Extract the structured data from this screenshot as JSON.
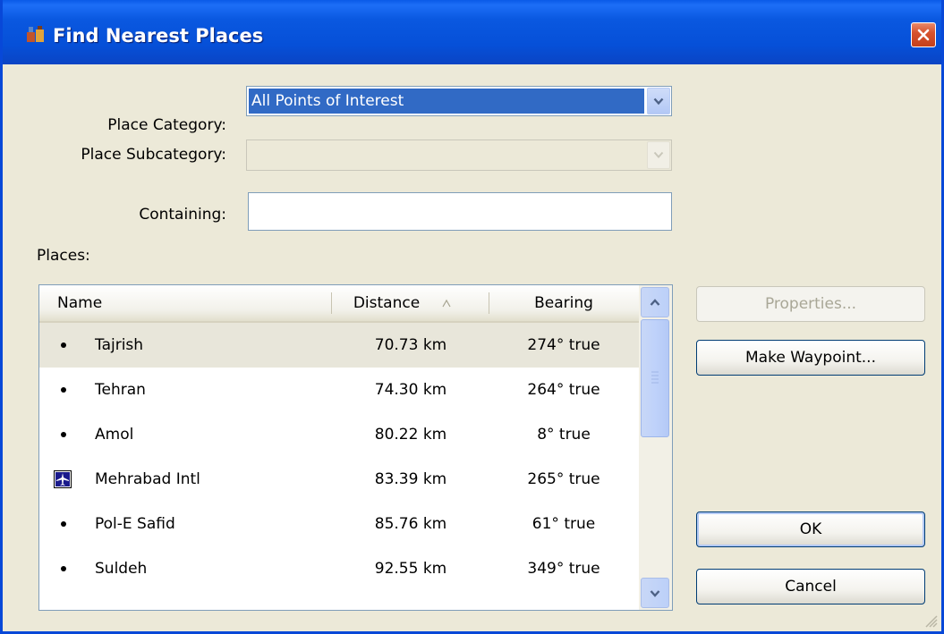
{
  "window": {
    "title": "Find Nearest Places",
    "icons": {
      "app": "find-places-icon",
      "close": "close-icon"
    }
  },
  "form": {
    "category_label": "Place Category:",
    "category_value": "All Points of Interest",
    "subcategory_label": "Place Subcategory:",
    "subcategory_value": "",
    "containing_label": "Containing:",
    "containing_value": "",
    "places_label": "Places:"
  },
  "list": {
    "columns": [
      "Name",
      "Distance",
      "Bearing"
    ],
    "sort_column": "Distance",
    "rows": [
      {
        "icon": "bullet-icon",
        "name": "Tajrish",
        "distance": "70.73 km",
        "bearing": "274° true"
      },
      {
        "icon": "bullet-icon",
        "name": "Tehran",
        "distance": "74.30 km",
        "bearing": "264° true"
      },
      {
        "icon": "bullet-icon",
        "name": "Amol",
        "distance": "80.22 km",
        "bearing": "8° true"
      },
      {
        "icon": "airport-icon",
        "name": "Mehrabad Intl",
        "distance": "83.39 km",
        "bearing": "265° true"
      },
      {
        "icon": "bullet-icon",
        "name": "Pol-E Safid",
        "distance": "85.76 km",
        "bearing": "61° true"
      },
      {
        "icon": "bullet-icon",
        "name": "Suldeh",
        "distance": "92.55 km",
        "bearing": "349° true"
      }
    ]
  },
  "buttons": {
    "properties": "Properties...",
    "make_waypoint": "Make Waypoint...",
    "ok": "OK",
    "cancel": "Cancel"
  },
  "colors": {
    "title_bar": "#0a58e0",
    "selection": "#316ac5",
    "dialog_bg": "#ece9d8"
  }
}
